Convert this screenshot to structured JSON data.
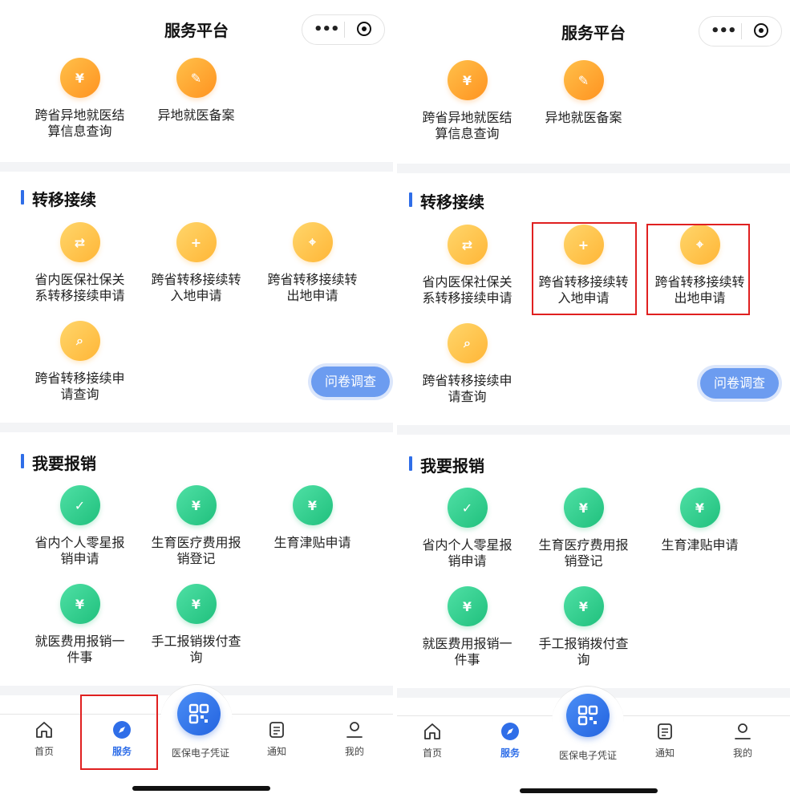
{
  "nav": {
    "title": "服务平台",
    "more_glyph": "•••"
  },
  "colors": {
    "accent": "#2f6ee8",
    "highlight": "#e02020",
    "orange": "#ff9f2e",
    "green": "#26c784"
  },
  "top_items": [
    {
      "label_l1": "跨省异地就医结",
      "label_l2": "算信息查询",
      "icon": "receipt-yuan-icon",
      "glyph": "¥"
    },
    {
      "label_l1": "异地就医备案",
      "label_l2": "",
      "icon": "edit-document-icon",
      "glyph": "✎"
    }
  ],
  "transfer": {
    "title": "转移接续",
    "items": [
      {
        "label_l1": "省内医保社保关",
        "label_l2": "系转移接续申请",
        "icon": "transfer-document-icon",
        "glyph": "⇄"
      },
      {
        "label_l1": "跨省转移接续转",
        "label_l2": "入地申请",
        "icon": "transfer-in-icon",
        "glyph": "+"
      },
      {
        "label_l1": "跨省转移接续转",
        "label_l2": "出地申请",
        "icon": "location-out-icon",
        "glyph": "⌖"
      },
      {
        "label_l1": "跨省转移接续申",
        "label_l2": "请查询",
        "icon": "search-hand-icon",
        "glyph": "⌕"
      }
    ],
    "survey_label": "问卷调查"
  },
  "reimburse": {
    "title": "我要报销",
    "items": [
      {
        "label_l1": "省内个人零星报",
        "label_l2": "销申请",
        "icon": "calendar-check-icon",
        "glyph": "✓"
      },
      {
        "label_l1": "生育医疗费用报",
        "label_l2": "销登记",
        "icon": "money-bag-icon",
        "glyph": "¥"
      },
      {
        "label_l1": "生育津贴申请",
        "label_l2": "",
        "icon": "yuan-coin-icon",
        "glyph": "¥"
      },
      {
        "label_l1": "就医费用报销一",
        "label_l2": "件事",
        "icon": "yuan-chat-icon",
        "glyph": "¥"
      },
      {
        "label_l1": "手工报销拨付查",
        "label_l2": "询",
        "icon": "yuan-hand-icon",
        "glyph": "¥"
      }
    ]
  },
  "tabbar": {
    "home": "首页",
    "service": "服务",
    "center": "医保电子凭证",
    "notice": "通知",
    "mine": "我的"
  }
}
